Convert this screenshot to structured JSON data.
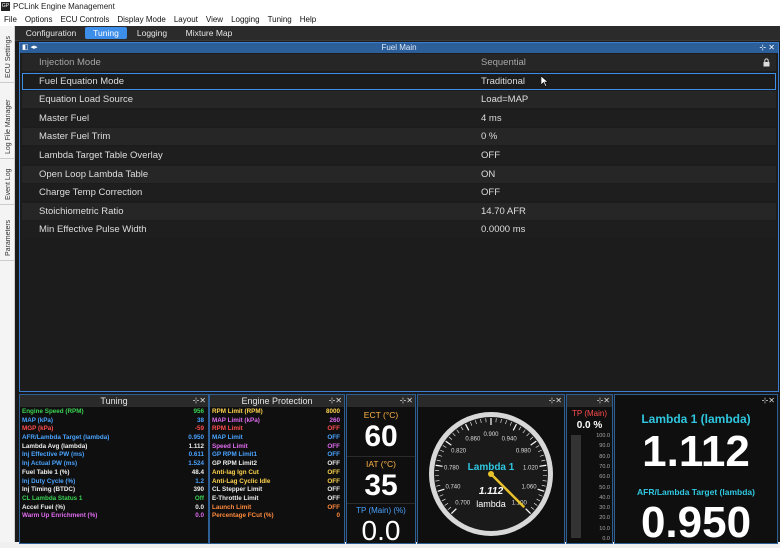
{
  "titlebar": {
    "icon_text": "GP",
    "title": "PCLink Engine Management"
  },
  "menu": [
    "File",
    "Options",
    "ECU Controls",
    "Display Mode",
    "Layout",
    "View",
    "Logging",
    "Tuning",
    "Help"
  ],
  "sidebar_tabs": [
    "ECU Settings",
    "Log File Manager",
    "Event Log",
    "Parameters"
  ],
  "tabs": [
    {
      "label": "Configuration",
      "active": false
    },
    {
      "label": "Tuning",
      "active": true
    },
    {
      "label": "Logging",
      "active": false
    },
    {
      "label": "Mixture Map",
      "active": false
    }
  ],
  "fuel_main": {
    "title": "Fuel Main",
    "rows": [
      {
        "name": "Injection Mode",
        "value": "Sequential",
        "locked": true
      },
      {
        "name": "Fuel Equation Mode",
        "value": "Traditional",
        "selected": true
      },
      {
        "name": "Equation Load Source",
        "value": "Load=MAP"
      },
      {
        "name": "Master Fuel",
        "value": "4 ms"
      },
      {
        "name": "Master Fuel Trim",
        "value": "0 %"
      },
      {
        "name": "Lambda Target Table Overlay",
        "value": "OFF"
      },
      {
        "name": "Open Loop Lambda Table",
        "value": "ON"
      },
      {
        "name": "Charge Temp Correction",
        "value": "OFF"
      },
      {
        "name": "Stoichiometric Ratio",
        "value": "14.70 AFR"
      },
      {
        "name": "Min Effective Pulse Width",
        "value": "0.0000 ms"
      }
    ]
  },
  "tuning_panel": {
    "title": "Tuning",
    "items": [
      {
        "k": "Engine Speed (RPM)",
        "v": "956",
        "color": "#39d353"
      },
      {
        "k": "MAP (kPa)",
        "v": "38",
        "color": "#4aa3ff"
      },
      {
        "k": "MGP (kPa)",
        "v": "-59",
        "color": "#ff4d4d"
      },
      {
        "k": "AFR/Lambda Target (lambda)",
        "v": "0.950",
        "color": "#4aa3ff"
      },
      {
        "k": "Lambda Avg (lambda)",
        "v": "1.112",
        "color": "#eeeeee"
      },
      {
        "k": "Inj Effective PW (ms)",
        "v": "0.611",
        "color": "#4aa3ff"
      },
      {
        "k": "Inj Actual PW (ms)",
        "v": "1.524",
        "color": "#4aa3ff"
      },
      {
        "k": "Fuel Table 1 (%)",
        "v": "48.4",
        "color": "#eeeeee"
      },
      {
        "k": "Inj Duty Cycle (%)",
        "v": "1.2",
        "color": "#4aa3ff"
      },
      {
        "k": "Inj Timing (BTDC)",
        "v": "390",
        "color": "#eeeeee"
      },
      {
        "k": "CL Lambda Status 1",
        "v": "Off",
        "color": "#39d353"
      },
      {
        "k": "Accel Fuel (%)",
        "v": "0.0",
        "color": "#eeeeee"
      },
      {
        "k": "Warm Up Enrichment (%)",
        "v": "0.0",
        "color": "#e06cf0"
      }
    ]
  },
  "protection_panel": {
    "title": "Engine Protection",
    "items": [
      {
        "k": "RPM Limit (RPM)",
        "v": "8000",
        "color": "#ffd34d"
      },
      {
        "k": "MAP Limit (kPa)",
        "v": "260",
        "color": "#e06cf0"
      },
      {
        "k": "RPM Limit",
        "v": "OFF",
        "color": "#ff4d4d"
      },
      {
        "k": "MAP Limit",
        "v": "OFF",
        "color": "#4aa3ff"
      },
      {
        "k": "Speed Limit",
        "v": "OFF",
        "color": "#e06cf0"
      },
      {
        "k": "GP RPM Limit1",
        "v": "OFF",
        "color": "#4aa3ff"
      },
      {
        "k": "GP RPM Limit2",
        "v": "OFF",
        "color": "#eeeeee"
      },
      {
        "k": "Anti-lag Ign Cut",
        "v": "OFF",
        "color": "#ffd34d"
      },
      {
        "k": "Anti-Lag Cyclic Idle",
        "v": "OFF",
        "color": "#ffd34d"
      },
      {
        "k": "CL Stepper Limit",
        "v": "OFF",
        "color": "#eeeeee"
      },
      {
        "k": "E-Throttle Limit",
        "v": "OFF",
        "color": "#eeeeee"
      },
      {
        "k": "Launch Limit",
        "v": "OFF",
        "color": "#ff8a3d"
      },
      {
        "k": "Percentage FCut (%)",
        "v": "0",
        "color": "#ff8a3d"
      }
    ]
  },
  "temps": {
    "ect_label": "ECT (°C)",
    "ect_value": "60",
    "iat_label": "IAT (°C)",
    "iat_value": "35",
    "tp_label": "TP (Main) (%)",
    "tp_value": "0.0"
  },
  "gauge": {
    "name": "Lambda 1",
    "value": "1.112",
    "unit": "lambda",
    "ticks": [
      "0.700",
      "0.740",
      "0.780",
      "0.820",
      "0.860",
      "0.900",
      "0.940",
      "0.980",
      "1.020",
      "1.060",
      "1.100"
    ],
    "min": 0.7,
    "max": 1.1,
    "needle": 1.112
  },
  "tp_bar": {
    "label": "TP (Main)",
    "value": "0.0 %",
    "scale": [
      "100.0",
      "90.0",
      "80.0",
      "70.0",
      "60.0",
      "50.0",
      "40.0",
      "30.0",
      "20.0",
      "10.0",
      "0.0"
    ],
    "fill_percent": 0
  },
  "lambda_panel": {
    "label1": "Lambda 1 (lambda)",
    "value1": "1.112",
    "label2": "AFR/Lambda Target (lambda)",
    "value2": "0.950"
  },
  "colors": {
    "accent": "#3d8ee8",
    "cyan": "#2fc7e0",
    "panel_border": "#2d5e96"
  }
}
